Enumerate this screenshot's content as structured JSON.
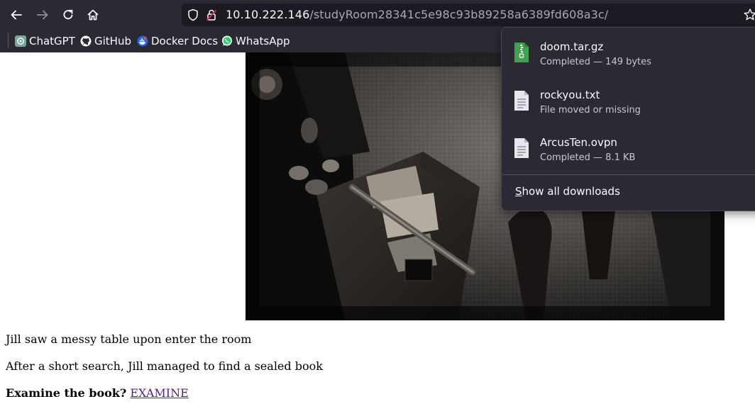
{
  "browser": {
    "url_host": "10.10.222.146",
    "url_path": "/studyRoom28341c5e98c93b89258a6389fd608a3c/",
    "bookmarks": [
      {
        "label": "ChatGPT",
        "icon": "chatgpt-icon"
      },
      {
        "label": "GitHub",
        "icon": "github-icon"
      },
      {
        "label": "Docker Docs",
        "icon": "docker-icon"
      },
      {
        "label": "WhatsApp",
        "icon": "whatsapp-icon"
      }
    ]
  },
  "downloads": {
    "items": [
      {
        "name": "doom.tar.gz",
        "status": "Completed — 149 bytes",
        "icon": "archive-file-icon"
      },
      {
        "name": "rockyou.txt",
        "status": "File moved or missing",
        "icon": "text-file-icon"
      },
      {
        "name": "ArcusTen.ovpn",
        "status": "Completed — 8.1 KB",
        "icon": "text-file-icon"
      }
    ],
    "show_all_accesskey": "S",
    "show_all_rest": "how all downloads"
  },
  "page": {
    "line1": "Jill saw a messy table upon enter the room",
    "line2": "After a short search, Jill managed to find a sealed book",
    "question": "Examine the book?",
    "link": "EXAMINE"
  },
  "colors": {
    "chrome_bg": "#2b2a33",
    "url_bg": "#1c1b22",
    "link_visited": "#551a8b",
    "archive_green": "#3fa24f"
  }
}
